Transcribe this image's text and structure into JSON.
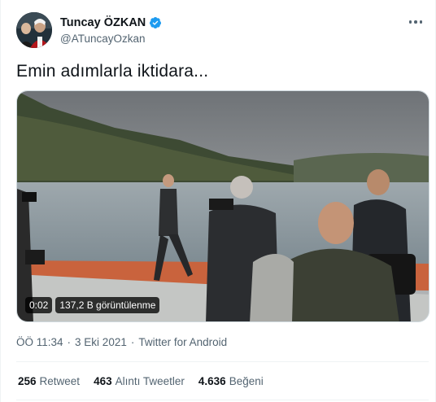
{
  "author": {
    "display_name": "Tuncay ÖZKAN",
    "handle": "@ATuncayOzkan",
    "verified": true
  },
  "colors": {
    "verified_blue": "#1d9bf0",
    "secondary_text": "#536471",
    "primary_text": "#0f1419"
  },
  "icons": {
    "more": "more-horizontal-icon",
    "verified": "verified-badge-icon"
  },
  "tweet": {
    "text": "Emin adımlarla iktidara..."
  },
  "video": {
    "duration": "0:02",
    "views": "137,2 B görüntülenme"
  },
  "meta": {
    "time": "ÖÖ 11:34",
    "sep1": "·",
    "date": "3 Eki 2021",
    "sep2": "·",
    "source": "Twitter for Android"
  },
  "stats": [
    {
      "count": "256",
      "label": "Retweet"
    },
    {
      "count": "463",
      "label": "Alıntı Tweetler"
    },
    {
      "count": "4.636",
      "label": "Beğeni"
    }
  ]
}
